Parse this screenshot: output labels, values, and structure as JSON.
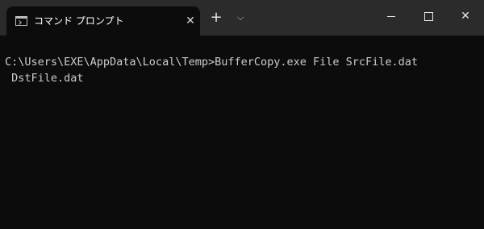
{
  "tab": {
    "icon": "console-icon",
    "title": "コマンド プロンプト",
    "close_glyph": "✕"
  },
  "titlebar": {
    "new_tab_glyph": "+",
    "dropdown_glyph": "⌵",
    "close_glyph": "✕"
  },
  "terminal": {
    "lines": [
      "C:\\Users\\EXE\\AppData\\Local\\Temp>BufferCopy.exe File SrcFile.dat",
      " DstFile.dat"
    ]
  },
  "colors": {
    "titlebar_bg": "#2b2b2b",
    "tab_bg": "#0c0c0c",
    "terminal_bg": "#0c0c0c",
    "terminal_text": "#cccccc"
  }
}
